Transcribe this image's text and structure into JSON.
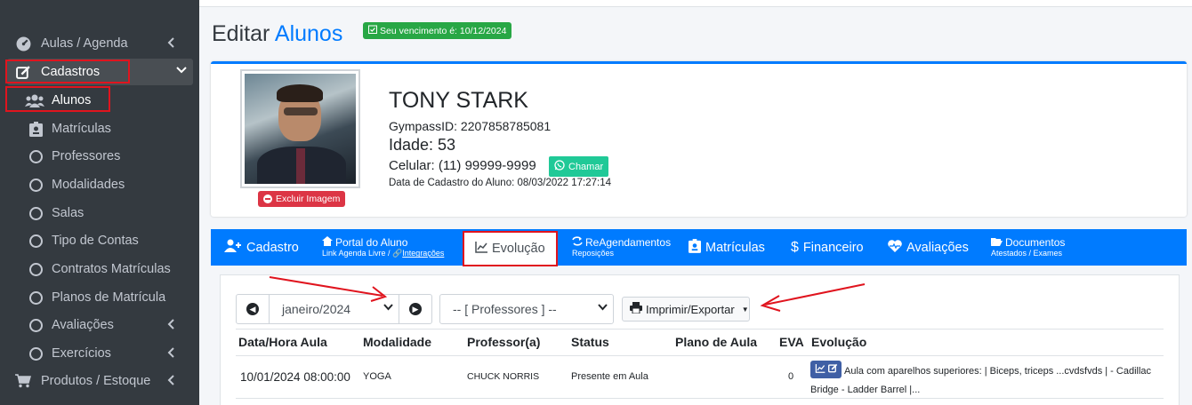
{
  "sidebar": {
    "items": [
      {
        "label": "Aulas / Agenda",
        "icon": "tachometer-icon"
      },
      {
        "label": "Cadastros",
        "icon": "edit-icon"
      },
      {
        "label": "Alunos",
        "icon": "users-icon"
      },
      {
        "label": "Matrículas",
        "icon": "id-badge-icon"
      },
      {
        "label": "Professores",
        "icon": "circle-icon"
      },
      {
        "label": "Modalidades",
        "icon": "circle-icon"
      },
      {
        "label": "Salas",
        "icon": "circle-icon"
      },
      {
        "label": "Tipo de Contas",
        "icon": "circle-icon"
      },
      {
        "label": "Contratos Matrículas",
        "icon": "circle-icon"
      },
      {
        "label": "Planos de Matrícula",
        "icon": "circle-icon"
      },
      {
        "label": "Avaliações",
        "icon": "circle-icon"
      },
      {
        "label": "Exercícios",
        "icon": "circle-icon"
      },
      {
        "label": "Produtos / Estoque",
        "icon": "cart-icon"
      }
    ]
  },
  "header": {
    "title_prefix": "Editar",
    "title_accent": "Alunos",
    "due_badge": "Seu vencimento é: 10/12/2024"
  },
  "profile": {
    "name": "TONY STARK",
    "gympass": "GympassID: 2207858785081",
    "age": "Idade: 53",
    "phone": "Celular: (11) 99999-9999",
    "chat_label": "Chamar",
    "registration": "Data de Cadastro do Aluno: 08/03/2022 17:27:14",
    "delete_image_label": "Excluir Imagem"
  },
  "tabs": {
    "cadastro": "Cadastro",
    "portal": "Portal do Aluno",
    "portal_sub": "Link Agenda Livre /",
    "portal_sub_link": "Integrações",
    "evolucao": "Evolução",
    "reagend": "ReAgendamentos",
    "reagend_sub": "Reposições",
    "matriculas": "Matrículas",
    "financeiro": "Financeiro",
    "avaliacoes": "Avaliações",
    "documentos": "Documentos",
    "documentos_sub": "Atestados / Exames"
  },
  "filters": {
    "month": "janeiro/2024",
    "professor": "-- [ Professores ] --",
    "print_label": "Imprimir/Exportar"
  },
  "table": {
    "columns": [
      "Data/Hora Aula",
      "Modalidade",
      "Professor(a)",
      "Status",
      "Plano de Aula",
      "EVA",
      "Evolução"
    ],
    "rows": [
      {
        "datetime": "10/01/2024 08:00:00",
        "modalidade": "YOGA",
        "professor": "CHUCK NORRIS",
        "status": "Presente em Aula",
        "plano": "",
        "eva": "0",
        "evolucao": "Aula com aparelhos superiores: | Biceps, triceps ...cvdsfvds | - Cadillac Bridge - Ladder Barrel |..."
      }
    ]
  },
  "colors": {
    "sidebar_bg": "#343a40",
    "primary": "#007bff",
    "success": "#28a745",
    "danger": "#dc3545",
    "chat": "#20c997",
    "annotation_red": "#e0141e"
  }
}
